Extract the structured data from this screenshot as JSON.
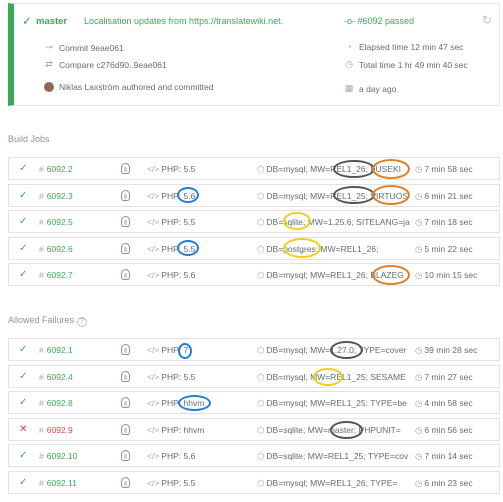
{
  "header": {
    "branch": "master",
    "message": "Localisation updates from https://translatewiki.net.",
    "status": "#6092 passed",
    "commit": "Commit 9eae061",
    "compare": "Compare c276d90..9eae061",
    "author": "Niklas Laxström authored and committed",
    "elapsed": "Elapsed time 12 min 47 sec",
    "total": "Total time 1 hr 49 min 40 sec",
    "ago": "a day ago"
  },
  "sections": {
    "build_jobs": "Build Jobs",
    "allowed_failures": "Allowed Failures"
  },
  "build_jobs": [
    {
      "num": "6092.2",
      "status": "passed",
      "lang": "PHP: 5.5",
      "env": "DB=mysql; MW=REL1_26; FUSEKI",
      "dur": "7 min 58 sec"
    },
    {
      "num": "6092.3",
      "status": "passed",
      "lang": "PHP: 5.6",
      "env": "DB=mysql; MW=REL1_25; VIRTUOS",
      "dur": "6 min 21 sec"
    },
    {
      "num": "6092.5",
      "status": "passed",
      "lang": "PHP: 5.5",
      "env": "DB=sqlite; MW=1.25.6; SITELANG=ja",
      "dur": "7 min 18 sec"
    },
    {
      "num": "6092.6",
      "status": "passed",
      "lang": "PHP: 5.5",
      "env": "DB=postgres; MW=REL1_26;",
      "dur": "5 min 22 sec"
    },
    {
      "num": "6092.7",
      "status": "passed",
      "lang": "PHP: 5.6",
      "env": "DB=mysql; MW=REL1_26; BLAZEG",
      "dur": "10 min 15 sec"
    }
  ],
  "allowed_failures": [
    {
      "num": "6092.1",
      "status": "passed",
      "lang": "PHP: 7",
      "env": "DB=mysql; MW=1.27.0; TYPE=cover",
      "dur": "39 min 28 sec"
    },
    {
      "num": "6092.4",
      "status": "passed",
      "lang": "PHP: 5.5",
      "env": "DB=mysql; MW=REL1_25; SESAME",
      "dur": "7 min 27 sec"
    },
    {
      "num": "6092.8",
      "status": "passed",
      "lang": "PHP: hhvm",
      "env": "DB=mysql; MW=REL1_25; TYPE=be",
      "dur": "4 min 58 sec"
    },
    {
      "num": "6092.9",
      "status": "failed",
      "lang": "PHP: hhvm",
      "env": "DB=sqlite; MW=master; PHPUNIT=",
      "dur": "6 min 56 sec"
    },
    {
      "num": "6092.10",
      "status": "passed",
      "lang": "PHP: 5.6",
      "env": "DB=sqlite; MW=REL1_25; TYPE=cov",
      "dur": "7 min 14 sec"
    },
    {
      "num": "6092.11",
      "status": "passed",
      "lang": "PHP: 5.5",
      "env": "DB=mysql; MW=REL1_26; TYPE=",
      "dur": "6 min 23 sec"
    }
  ],
  "colors": {
    "passed": "#39aa56",
    "failed": "#db4545",
    "annotation_gray": "#555555",
    "annotation_orange": "#e67e22",
    "annotation_blue": "#1f7fd8",
    "annotation_yellow": "#f0cf1c"
  }
}
